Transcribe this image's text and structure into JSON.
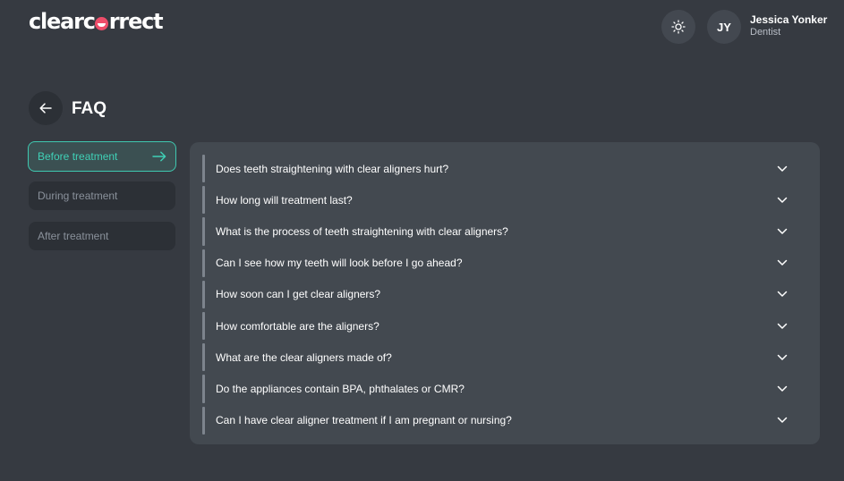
{
  "header": {
    "logo": {
      "part1": "clearc",
      "part2": "rrect"
    },
    "theme_icon": "sun-icon",
    "user": {
      "initials": "JY",
      "name": "Jessica Yonker",
      "role": "Dentist"
    }
  },
  "page": {
    "title": "FAQ",
    "back_icon": "arrow-left-icon"
  },
  "colors": {
    "accent": "#3fd0b6",
    "logo_accent": "#ee4d6a",
    "background": "#363a41",
    "panel": "#434950"
  },
  "sidebar": {
    "tabs": [
      {
        "label": "Before treatment",
        "active": true
      },
      {
        "label": "During treatment",
        "active": false
      },
      {
        "label": "After treatment",
        "active": false
      }
    ]
  },
  "faq": {
    "questions": [
      "Does teeth straightening with clear aligners hurt?",
      "How long will treatment last?",
      "What is the process of teeth straightening with clear aligners?",
      "Can I see how my teeth will look before I go ahead?",
      "How soon can I get clear aligners?",
      "How comfortable are the aligners?",
      "What are the clear aligners made of?",
      "Do the appliances contain BPA, phthalates or CMR?",
      "Can I have clear aligner treatment if I am pregnant or nursing?"
    ]
  }
}
